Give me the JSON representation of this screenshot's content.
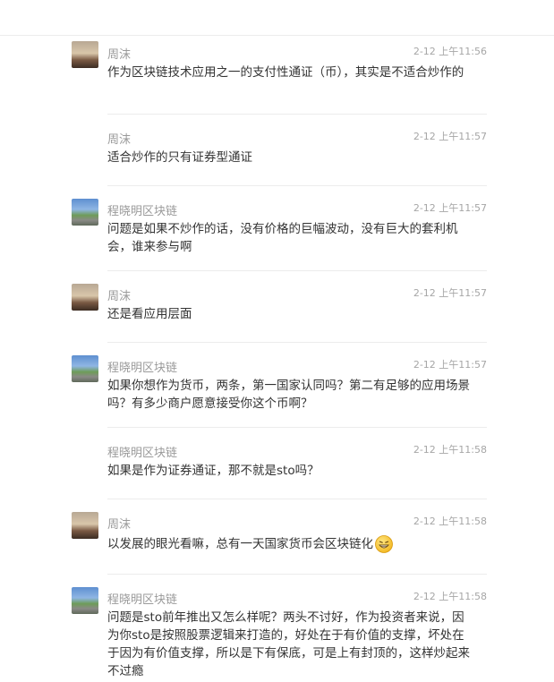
{
  "messages": [
    {
      "author": "周沫",
      "avatar": "dusk",
      "time": "2-12 上午11:56",
      "text": "作为区块链技术应用之一的支付性通证（币），其实是不适合炒作的"
    },
    {
      "author": "周沫",
      "avatar": null,
      "time": "2-12 上午11:57",
      "text": "适合炒作的只有证券型通证"
    },
    {
      "author": "程晓明区块链",
      "avatar": "road",
      "time": "2-12 上午11:57",
      "text": "问题是如果不炒作的话，没有价格的巨幅波动，没有巨大的套利机会，谁来参与啊"
    },
    {
      "author": "周沫",
      "avatar": "dusk",
      "time": "2-12 上午11:57",
      "text": "还是看应用层面"
    },
    {
      "author": "程晓明区块链",
      "avatar": "road",
      "time": "2-12 上午11:57",
      "text": "如果你想作为货币，两条，第一国家认同吗？第二有足够的应用场景吗？有多少商户愿意接受你这个币啊？"
    },
    {
      "author": "程晓明区块链",
      "avatar": null,
      "time": "2-12 上午11:58",
      "text": "如果是作为证券通证，那不就是sto吗？"
    },
    {
      "author": "周沫",
      "avatar": "dusk",
      "time": "2-12 上午11:58",
      "text": "以发展的眼光看嘛，总有一天国家货币会区块链化",
      "emoji": "grinning-face-icon"
    },
    {
      "author": "程晓明区块链",
      "avatar": "road",
      "time": "2-12 上午11:58",
      "text": "问题是sto前年推出又怎么样呢？两头不讨好，作为投资者来说，因为你sto是按照股票逻辑来打造的，好处在于有价值的支撑，坏处在于因为有价值支撑，所以是下有保底，可是上有封顶的，这样炒起来不过瘾"
    }
  ]
}
